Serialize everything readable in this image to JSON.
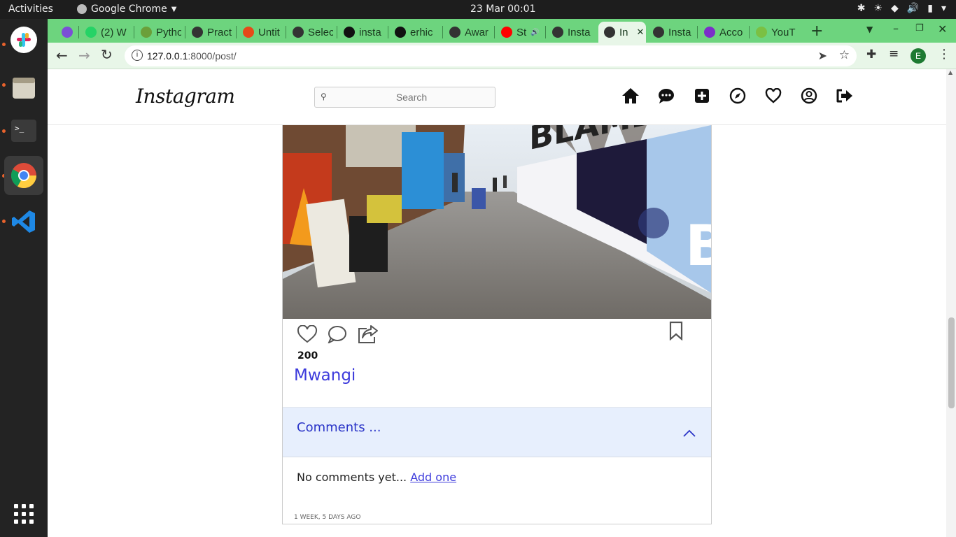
{
  "topbar": {
    "activities": "Activities",
    "app_name": "Google Chrome",
    "clock": "23 Mar  00:01"
  },
  "tabs": [
    {
      "label": "",
      "color": "#7b4fd6"
    },
    {
      "label": "(2) W",
      "color": "#25d366"
    },
    {
      "label": "Pytho",
      "color": "#6b9f3a"
    },
    {
      "label": "Pract",
      "color": "#333333"
    },
    {
      "label": "Untit",
      "color": "#e64a19"
    },
    {
      "label": "Selec",
      "color": "#333333"
    },
    {
      "label": "insta",
      "color": "#111111"
    },
    {
      "label": "erhic",
      "color": "#111111"
    },
    {
      "label": "Awar",
      "color": "#333333"
    },
    {
      "label": "St",
      "color": "#ff0000"
    },
    {
      "label": "Insta",
      "color": "#333333"
    },
    {
      "label": "In",
      "color": "#333333"
    },
    {
      "label": "Insta",
      "color": "#333333"
    },
    {
      "label": "Acco",
      "color": "#7b2fc9"
    },
    {
      "label": "YouT",
      "color": "#7bc043"
    }
  ],
  "browser": {
    "url_host": "127.0.0.1",
    "url_rest": ":8000/post/",
    "profile_initial": "E"
  },
  "ig": {
    "logo": "Instagram",
    "search_placeholder": "Search"
  },
  "post": {
    "likes": "200",
    "username": "Mwangi",
    "comments_header": "Comments ...",
    "no_comments": "No comments yet...",
    "add_one": "Add one",
    "timestamp": "1 WEEK, 5 DAYS AGO"
  },
  "colors": {
    "tabstrip": "#6dd47e",
    "toolbar": "#e8f6e8",
    "link": "#3d3bdc",
    "comments_bg": "#e7effd"
  }
}
